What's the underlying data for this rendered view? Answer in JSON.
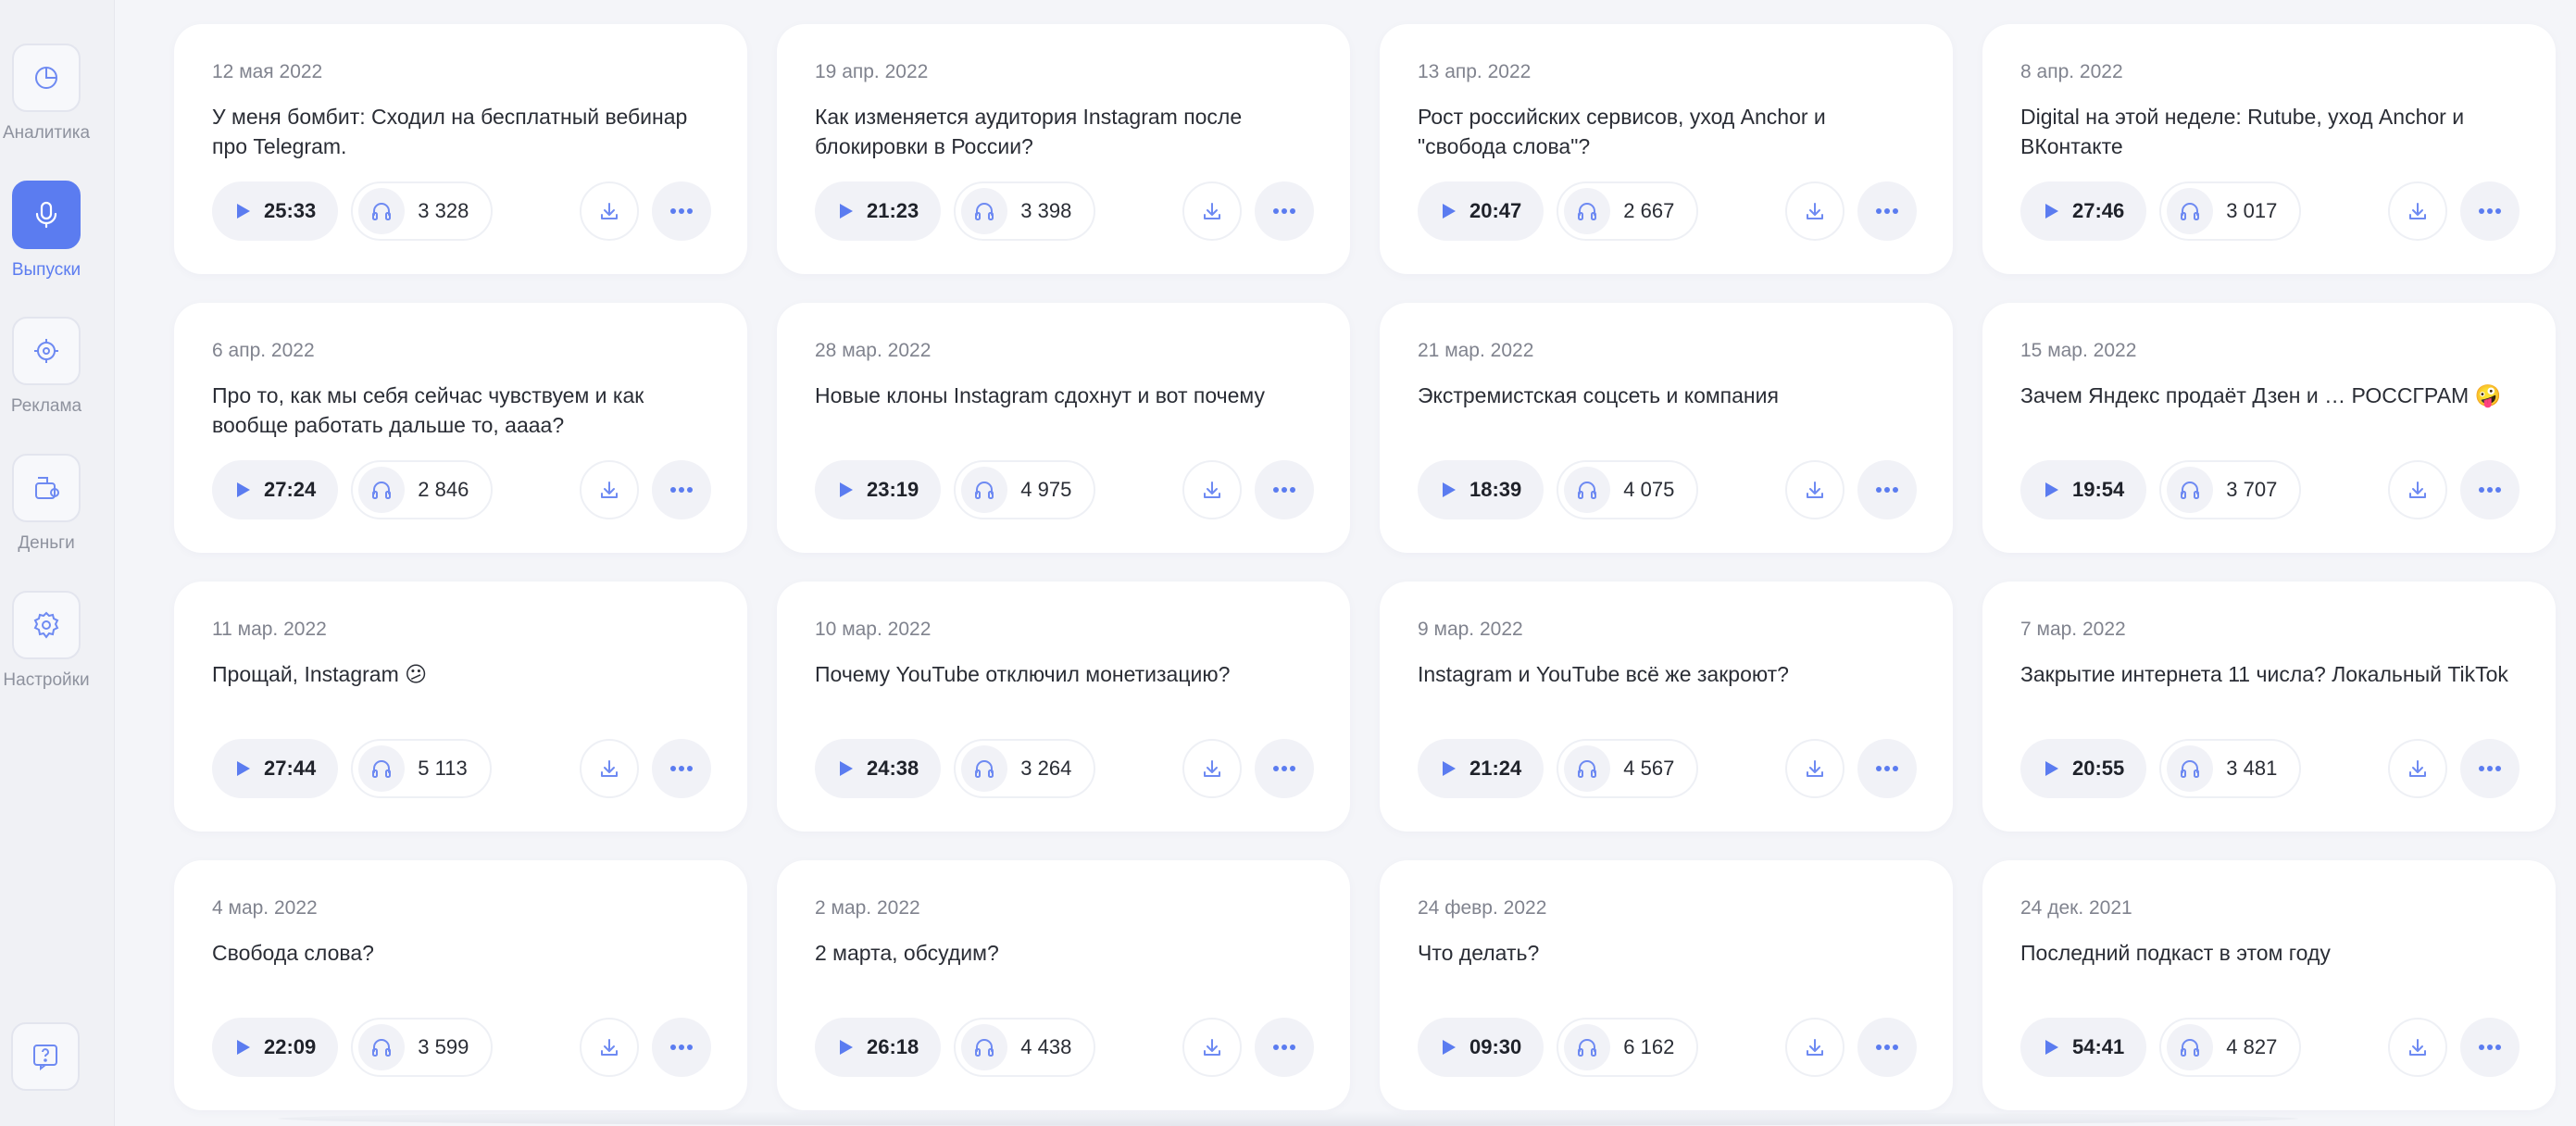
{
  "sidebar": {
    "items": [
      {
        "label": "Аналитика",
        "icon": "pie-chart-icon",
        "active": false
      },
      {
        "label": "Выпуски",
        "icon": "microphone-icon",
        "active": true
      },
      {
        "label": "Реклама",
        "icon": "target-icon",
        "active": false
      },
      {
        "label": "Деньги",
        "icon": "wallet-icon",
        "active": false
      },
      {
        "label": "Настройки",
        "icon": "gear-icon",
        "active": false
      }
    ],
    "help_icon": "help-icon"
  },
  "colors": {
    "accent": "#5b7cf0",
    "background": "#f4f5f9",
    "card": "#ffffff"
  },
  "episodes": [
    {
      "date": "12 мая 2022",
      "title": "У меня бомбит: Сходил на бесплатный вебинар про Telegram.",
      "duration": "25:33",
      "listens": "3 328"
    },
    {
      "date": "19 апр. 2022",
      "title": "Как изменяется аудитория Instagram после блокировки в России?",
      "duration": "21:23",
      "listens": "3 398"
    },
    {
      "date": "13 апр. 2022",
      "title": "Рост российских сервисов, уход Anchor и \"свобода слова\"?",
      "duration": "20:47",
      "listens": "2 667"
    },
    {
      "date": "8 апр. 2022",
      "title": "Digital на этой неделе: Rutube, уход Anchor и ВКонтакте",
      "duration": "27:46",
      "listens": "3 017"
    },
    {
      "date": "6 апр. 2022",
      "title": "Про то, как мы себя сейчас чувствуем и как вообще работать дальше то, аааа?",
      "duration": "27:24",
      "listens": "2 846"
    },
    {
      "date": "28 мар. 2022",
      "title": "Новые клоны Instagram сдохнут и вот почему",
      "duration": "23:19",
      "listens": "4 975"
    },
    {
      "date": "21 мар. 2022",
      "title": "Экстремистская соцсеть и компания",
      "duration": "18:39",
      "listens": "4 075"
    },
    {
      "date": "15 мар. 2022",
      "title": "Зачем Яндекс продаёт Дзен и … РОССГРАМ 🤪",
      "duration": "19:54",
      "listens": "3 707"
    },
    {
      "date": "11 мар. 2022",
      "title": "Прощай, Instagram 😕",
      "duration": "27:44",
      "listens": "5 113"
    },
    {
      "date": "10 мар. 2022",
      "title": "Почему YouTube отключил монетизацию?",
      "duration": "24:38",
      "listens": "3 264"
    },
    {
      "date": "9 мар. 2022",
      "title": "Instagram и YouTube всё же закроют?",
      "duration": "21:24",
      "listens": "4 567"
    },
    {
      "date": "7 мар. 2022",
      "title": "Закрытие интернета 11 числа? Локальный TikTok",
      "duration": "20:55",
      "listens": "3 481"
    },
    {
      "date": "4 мар. 2022",
      "title": "Свобода слова?",
      "duration": "22:09",
      "listens": "3 599"
    },
    {
      "date": "2 мар. 2022",
      "title": "2 марта, обсудим?",
      "duration": "26:18",
      "listens": "4 438"
    },
    {
      "date": "24 февр. 2022",
      "title": "Что делать?",
      "duration": "09:30",
      "listens": "6 162"
    },
    {
      "date": "24 дек. 2021",
      "title": "Последний подкаст в этом году",
      "duration": "54:41",
      "listens": "4 827"
    }
  ]
}
